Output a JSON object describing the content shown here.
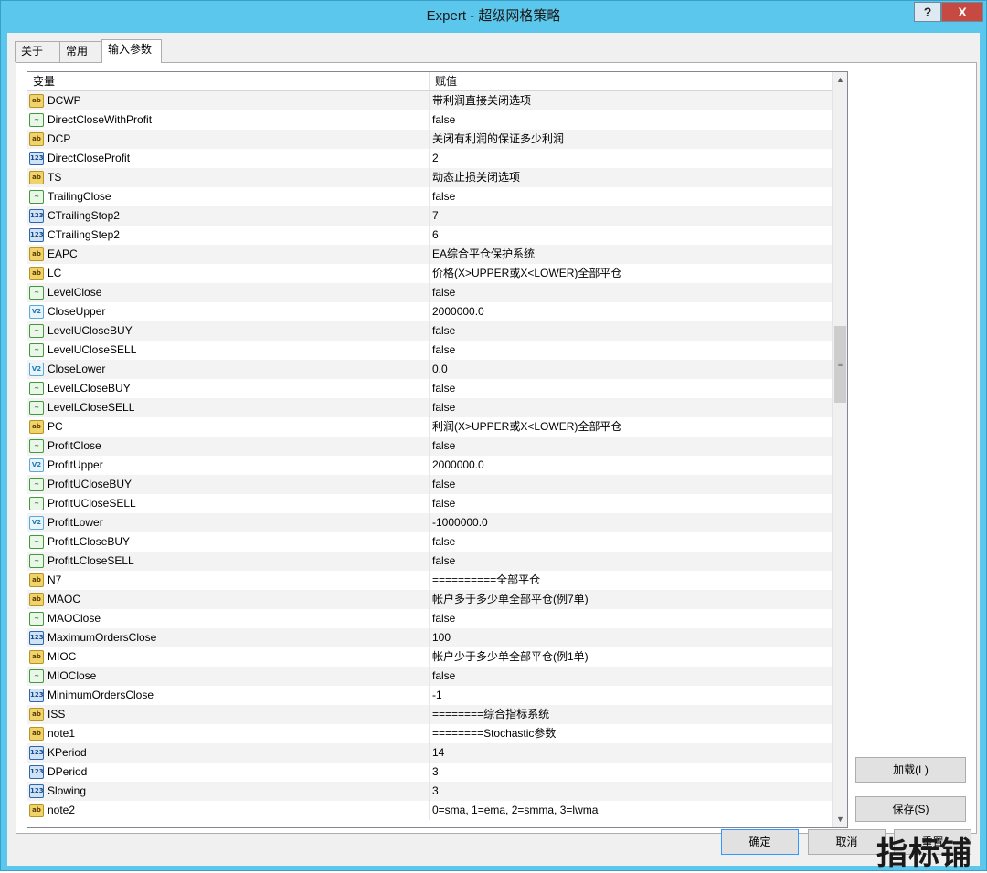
{
  "window": {
    "title": "Expert - 超级网格策略",
    "help": "?",
    "close": "X"
  },
  "tabs": [
    {
      "label": "关于",
      "active": false
    },
    {
      "label": "常用",
      "active": false
    },
    {
      "label": "输入参数",
      "active": true
    }
  ],
  "grid": {
    "col_variable": "变量",
    "col_value": "赋值",
    "rows": [
      {
        "type": "str",
        "name": "DCWP",
        "value": "带利润直接关闭选项"
      },
      {
        "type": "bool",
        "name": "DirectCloseWithProfit",
        "value": "false"
      },
      {
        "type": "str",
        "name": "DCP",
        "value": "关闭有利润的保证多少利润"
      },
      {
        "type": "int",
        "name": "DirectCloseProfit",
        "value": "2"
      },
      {
        "type": "str",
        "name": "TS",
        "value": "动态止损关闭选项"
      },
      {
        "type": "bool",
        "name": "TrailingClose",
        "value": "false"
      },
      {
        "type": "int",
        "name": "CTrailingStop2",
        "value": "7"
      },
      {
        "type": "int",
        "name": "CTrailingStep2",
        "value": "6"
      },
      {
        "type": "str",
        "name": "EAPC",
        "value": "EA综合平仓保护系统"
      },
      {
        "type": "str",
        "name": "LC",
        "value": "价格(X>UPPER或X<LOWER)全部平仓"
      },
      {
        "type": "bool",
        "name": "LevelClose",
        "value": "false"
      },
      {
        "type": "dbl",
        "name": "CloseUpper",
        "value": "2000000.0"
      },
      {
        "type": "bool",
        "name": "LevelUCloseBUY",
        "value": "false"
      },
      {
        "type": "bool",
        "name": "LevelUCloseSELL",
        "value": "false"
      },
      {
        "type": "dbl",
        "name": "CloseLower",
        "value": "0.0"
      },
      {
        "type": "bool",
        "name": "LevelLCloseBUY",
        "value": "false"
      },
      {
        "type": "bool",
        "name": "LevelLCloseSELL",
        "value": "false"
      },
      {
        "type": "str",
        "name": "PC",
        "value": "利润(X>UPPER或X<LOWER)全部平仓"
      },
      {
        "type": "bool",
        "name": "ProfitClose",
        "value": "false"
      },
      {
        "type": "dbl",
        "name": "ProfitUpper",
        "value": "2000000.0"
      },
      {
        "type": "bool",
        "name": "ProfitUCloseBUY",
        "value": "false"
      },
      {
        "type": "bool",
        "name": "ProfitUCloseSELL",
        "value": "false"
      },
      {
        "type": "dbl",
        "name": "ProfitLower",
        "value": "-1000000.0"
      },
      {
        "type": "bool",
        "name": "ProfitLCloseBUY",
        "value": "false"
      },
      {
        "type": "bool",
        "name": "ProfitLCloseSELL",
        "value": "false"
      },
      {
        "type": "str",
        "name": "N7",
        "value": "==========全部平仓"
      },
      {
        "type": "str",
        "name": "MAOC",
        "value": "帐户多于多少单全部平仓(例7单)"
      },
      {
        "type": "bool",
        "name": "MAOClose",
        "value": "false"
      },
      {
        "type": "int",
        "name": "MaximumOrdersClose",
        "value": "100"
      },
      {
        "type": "str",
        "name": "MIOC",
        "value": "帐户少于多少单全部平仓(例1单)"
      },
      {
        "type": "bool",
        "name": "MIOClose",
        "value": "false"
      },
      {
        "type": "int",
        "name": "MinimumOrdersClose",
        "value": "-1"
      },
      {
        "type": "str",
        "name": "ISS",
        "value": "========综合指标系统"
      },
      {
        "type": "str",
        "name": "note1",
        "value": "========Stochastic参数"
      },
      {
        "type": "int",
        "name": "KPeriod",
        "value": "14"
      },
      {
        "type": "int",
        "name": "DPeriod",
        "value": "3"
      },
      {
        "type": "int",
        "name": "Slowing",
        "value": "3"
      },
      {
        "type": "str",
        "name": "note2",
        "value": "0=sma, 1=ema, 2=smma, 3=lwma"
      }
    ]
  },
  "icons": {
    "str": "ab",
    "bool": "~",
    "int": "123",
    "dbl": "V2"
  },
  "buttons": {
    "load": "加载(L)",
    "save": "保存(S)",
    "ok": "确定",
    "cancel": "取消",
    "reset": "重置"
  },
  "watermark": "指标铺"
}
